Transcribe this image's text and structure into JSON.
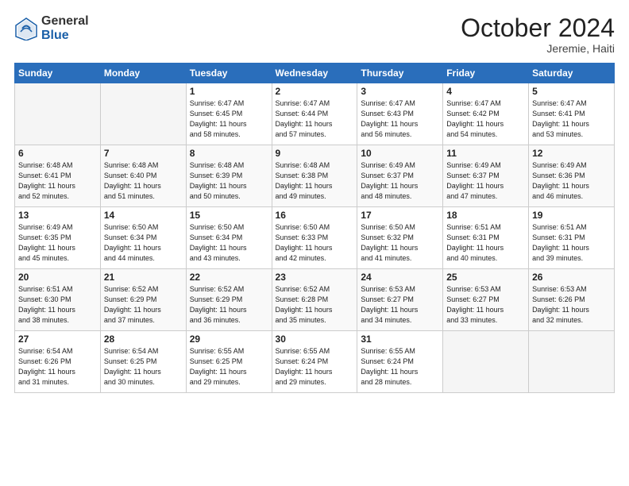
{
  "logo": {
    "general": "General",
    "blue": "Blue"
  },
  "title": "October 2024",
  "location": "Jeremie, Haiti",
  "days_of_week": [
    "Sunday",
    "Monday",
    "Tuesday",
    "Wednesday",
    "Thursday",
    "Friday",
    "Saturday"
  ],
  "weeks": [
    [
      {
        "num": "",
        "info": ""
      },
      {
        "num": "",
        "info": ""
      },
      {
        "num": "1",
        "info": "Sunrise: 6:47 AM\nSunset: 6:45 PM\nDaylight: 11 hours\nand 58 minutes."
      },
      {
        "num": "2",
        "info": "Sunrise: 6:47 AM\nSunset: 6:44 PM\nDaylight: 11 hours\nand 57 minutes."
      },
      {
        "num": "3",
        "info": "Sunrise: 6:47 AM\nSunset: 6:43 PM\nDaylight: 11 hours\nand 56 minutes."
      },
      {
        "num": "4",
        "info": "Sunrise: 6:47 AM\nSunset: 6:42 PM\nDaylight: 11 hours\nand 54 minutes."
      },
      {
        "num": "5",
        "info": "Sunrise: 6:47 AM\nSunset: 6:41 PM\nDaylight: 11 hours\nand 53 minutes."
      }
    ],
    [
      {
        "num": "6",
        "info": "Sunrise: 6:48 AM\nSunset: 6:41 PM\nDaylight: 11 hours\nand 52 minutes."
      },
      {
        "num": "7",
        "info": "Sunrise: 6:48 AM\nSunset: 6:40 PM\nDaylight: 11 hours\nand 51 minutes."
      },
      {
        "num": "8",
        "info": "Sunrise: 6:48 AM\nSunset: 6:39 PM\nDaylight: 11 hours\nand 50 minutes."
      },
      {
        "num": "9",
        "info": "Sunrise: 6:48 AM\nSunset: 6:38 PM\nDaylight: 11 hours\nand 49 minutes."
      },
      {
        "num": "10",
        "info": "Sunrise: 6:49 AM\nSunset: 6:37 PM\nDaylight: 11 hours\nand 48 minutes."
      },
      {
        "num": "11",
        "info": "Sunrise: 6:49 AM\nSunset: 6:37 PM\nDaylight: 11 hours\nand 47 minutes."
      },
      {
        "num": "12",
        "info": "Sunrise: 6:49 AM\nSunset: 6:36 PM\nDaylight: 11 hours\nand 46 minutes."
      }
    ],
    [
      {
        "num": "13",
        "info": "Sunrise: 6:49 AM\nSunset: 6:35 PM\nDaylight: 11 hours\nand 45 minutes."
      },
      {
        "num": "14",
        "info": "Sunrise: 6:50 AM\nSunset: 6:34 PM\nDaylight: 11 hours\nand 44 minutes."
      },
      {
        "num": "15",
        "info": "Sunrise: 6:50 AM\nSunset: 6:34 PM\nDaylight: 11 hours\nand 43 minutes."
      },
      {
        "num": "16",
        "info": "Sunrise: 6:50 AM\nSunset: 6:33 PM\nDaylight: 11 hours\nand 42 minutes."
      },
      {
        "num": "17",
        "info": "Sunrise: 6:50 AM\nSunset: 6:32 PM\nDaylight: 11 hours\nand 41 minutes."
      },
      {
        "num": "18",
        "info": "Sunrise: 6:51 AM\nSunset: 6:31 PM\nDaylight: 11 hours\nand 40 minutes."
      },
      {
        "num": "19",
        "info": "Sunrise: 6:51 AM\nSunset: 6:31 PM\nDaylight: 11 hours\nand 39 minutes."
      }
    ],
    [
      {
        "num": "20",
        "info": "Sunrise: 6:51 AM\nSunset: 6:30 PM\nDaylight: 11 hours\nand 38 minutes."
      },
      {
        "num": "21",
        "info": "Sunrise: 6:52 AM\nSunset: 6:29 PM\nDaylight: 11 hours\nand 37 minutes."
      },
      {
        "num": "22",
        "info": "Sunrise: 6:52 AM\nSunset: 6:29 PM\nDaylight: 11 hours\nand 36 minutes."
      },
      {
        "num": "23",
        "info": "Sunrise: 6:52 AM\nSunset: 6:28 PM\nDaylight: 11 hours\nand 35 minutes."
      },
      {
        "num": "24",
        "info": "Sunrise: 6:53 AM\nSunset: 6:27 PM\nDaylight: 11 hours\nand 34 minutes."
      },
      {
        "num": "25",
        "info": "Sunrise: 6:53 AM\nSunset: 6:27 PM\nDaylight: 11 hours\nand 33 minutes."
      },
      {
        "num": "26",
        "info": "Sunrise: 6:53 AM\nSunset: 6:26 PM\nDaylight: 11 hours\nand 32 minutes."
      }
    ],
    [
      {
        "num": "27",
        "info": "Sunrise: 6:54 AM\nSunset: 6:26 PM\nDaylight: 11 hours\nand 31 minutes."
      },
      {
        "num": "28",
        "info": "Sunrise: 6:54 AM\nSunset: 6:25 PM\nDaylight: 11 hours\nand 30 minutes."
      },
      {
        "num": "29",
        "info": "Sunrise: 6:55 AM\nSunset: 6:25 PM\nDaylight: 11 hours\nand 29 minutes."
      },
      {
        "num": "30",
        "info": "Sunrise: 6:55 AM\nSunset: 6:24 PM\nDaylight: 11 hours\nand 29 minutes."
      },
      {
        "num": "31",
        "info": "Sunrise: 6:55 AM\nSunset: 6:24 PM\nDaylight: 11 hours\nand 28 minutes."
      },
      {
        "num": "",
        "info": ""
      },
      {
        "num": "",
        "info": ""
      }
    ]
  ]
}
